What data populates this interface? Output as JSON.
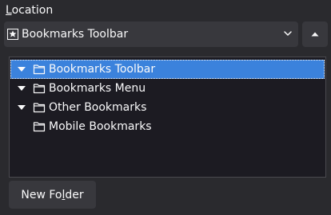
{
  "location": {
    "label_prefix": "",
    "label_accesskey": "L",
    "label_suffix": "ocation"
  },
  "folder_select": {
    "selected_label": "Bookmarks Toolbar",
    "icon": "bookmarks-toolbar-icon"
  },
  "expander": {
    "icon": "chevron-up-icon"
  },
  "tree": {
    "items": [
      {
        "label": "Bookmarks Toolbar",
        "expanded": true,
        "selected": true
      },
      {
        "label": "Bookmarks Menu",
        "expanded": true,
        "selected": false
      },
      {
        "label": "Other Bookmarks",
        "expanded": true,
        "selected": false
      },
      {
        "label": "Mobile Bookmarks",
        "expanded": false,
        "selected": false
      }
    ]
  },
  "new_folder": {
    "label_prefix": "New Fo",
    "label_accesskey": "l",
    "label_suffix": "der"
  },
  "colors": {
    "background": "#2a2a2e",
    "control": "#38383d",
    "tree_background": "#1c1b22",
    "selection": "#3b82dc",
    "text": "#f9f9fa"
  }
}
